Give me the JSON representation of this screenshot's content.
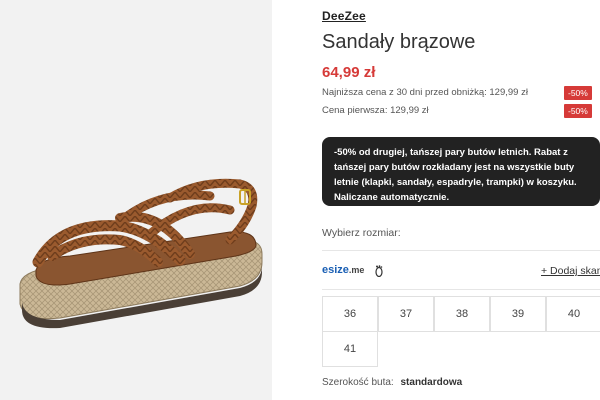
{
  "product": {
    "brand": "DeeZee",
    "title": "Sandały brązowe",
    "price": "64,99 zł",
    "lowest_price_label": "Najniższa cena z 30 dni przed obniżką: 129,99 zł",
    "lowest_price_badge": "-50%",
    "original_price_label": "Cena pierwsza: 129,99 zł",
    "original_price_badge": "-50%"
  },
  "promo": {
    "text": "-50% od drugiej, tańszej pary butów letnich. Rabat z tańszej pary butów rozkładany jest na wszystkie buty letnie (klapki, sandały, espadryle, trampki) w koszyku. Naliczane automatycznie."
  },
  "sizes": {
    "label": "Wybierz rozmiar:",
    "esize_brand": "esize",
    "esize_suffix": ".me",
    "foot_icon": "foot-icon",
    "add_size_label": "+ Dodaj skan",
    "options": [
      "36",
      "37",
      "38",
      "39",
      "40",
      "41"
    ]
  },
  "width": {
    "label": "Szerokość buta:",
    "value": "standardowa"
  },
  "colors": {
    "accent_red": "#d63a38",
    "promo_bg": "#222222",
    "esize_blue": "#1a5fb4",
    "sandal_brown": "#9a5a2e"
  }
}
